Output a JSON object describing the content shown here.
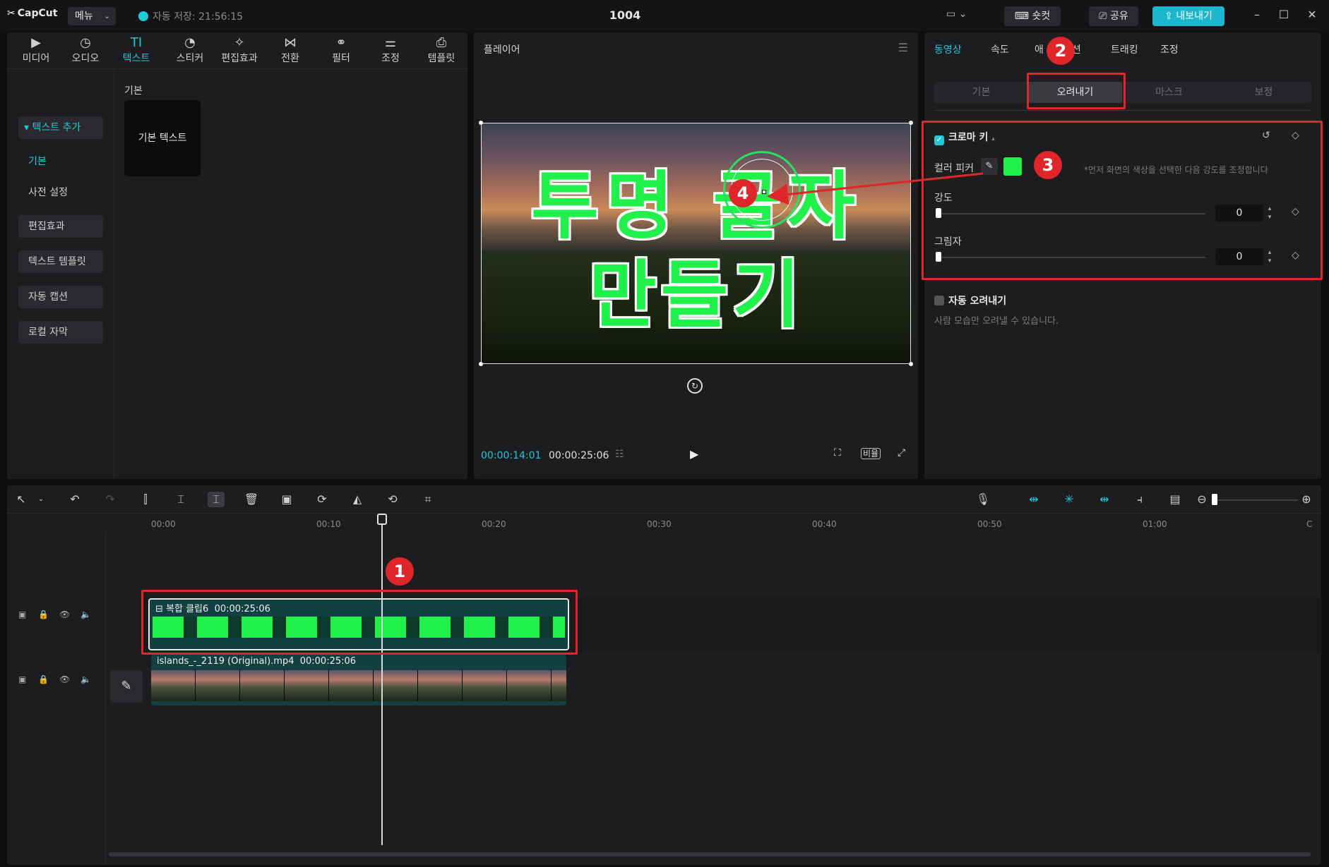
{
  "app": {
    "logo": "CapCut",
    "menu_label": "메뉴",
    "autosave": "자동 저장: 21:56:15",
    "project_title": "1004",
    "shortcut_label": "숏컷",
    "share_label": "공유",
    "export_label": "내보내기"
  },
  "media_tabs": [
    {
      "label": "미디어",
      "icon": "media-icon"
    },
    {
      "label": "오디오",
      "icon": "audio-icon"
    },
    {
      "label": "텍스트",
      "icon": "text-icon"
    },
    {
      "label": "스티커",
      "icon": "sticker-icon"
    },
    {
      "label": "편집효과",
      "icon": "effects-icon"
    },
    {
      "label": "전환",
      "icon": "transition-icon"
    },
    {
      "label": "필터",
      "icon": "filter-icon"
    },
    {
      "label": "조정",
      "icon": "adjust-icon"
    },
    {
      "label": "템플릿",
      "icon": "template-icon"
    }
  ],
  "side_nav": {
    "add_text": "텍스트 추가",
    "basic": "기본",
    "presets": "사전 설정",
    "effects": "편집효과",
    "text_template": "텍스트 템플릿",
    "auto_caption": "자동 캡션",
    "local_caption": "로컬 자막"
  },
  "text_section": {
    "label": "기본",
    "card_label": "기본 텍스트"
  },
  "player": {
    "title": "플레이어",
    "overlay_line1": "투명 글자",
    "overlay_line2": "만들기",
    "current_time": "00:00:14:01",
    "total_time": "00:00:25:06",
    "ratio_label": "비율"
  },
  "inspector": {
    "tabs": [
      "동영상",
      "속도",
      "애니메이션",
      "트래킹",
      "조정"
    ],
    "tab_partial_a": "애",
    "tab_partial_b": "션",
    "sub_tabs": [
      "기본",
      "오려내기",
      "마스크",
      "보정"
    ],
    "chroma": {
      "title": "크로마 키",
      "picker_label": "컬러 피커",
      "picked_color": "#1ff14a",
      "hint": "*먼저 화면의 색상을 선택한 다음 강도를 조정합니다",
      "intensity_label": "강도",
      "intensity_value": "0",
      "shadow_label": "그림자",
      "shadow_value": "0"
    },
    "auto_cutout": {
      "title": "자동 오려내기",
      "hint": "사람 모습만 오려낼 수 있습니다."
    }
  },
  "timeline": {
    "ticks": [
      "00:00",
      "00:10",
      "00:20",
      "00:30",
      "00:40",
      "00:50",
      "01:00",
      "C"
    ],
    "compound_clip": {
      "name": "복합 클립6",
      "duration": "00:00:25:06"
    },
    "video_clip": {
      "name": "islands_-_2119 (Original).mp4",
      "duration": "00:00:25:06"
    }
  },
  "annotations": [
    "1",
    "2",
    "3",
    "4"
  ],
  "colors": {
    "accent": "#22c7d8",
    "chroma_green": "#1ff14a",
    "annotation_red": "#e0262b"
  }
}
